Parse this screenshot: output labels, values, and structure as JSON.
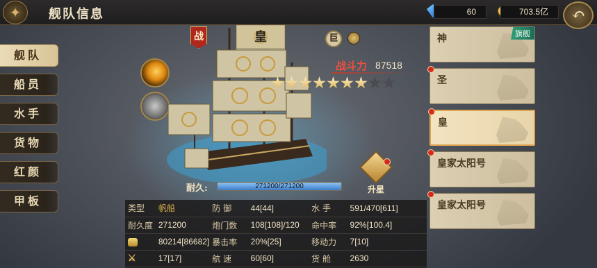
{
  "header": {
    "title": "舰队信息",
    "gems": "60",
    "gold": "703.5亿",
    "back_icon": "back-arrow-icon"
  },
  "left_tabs": [
    {
      "label": "舰队",
      "active": true
    },
    {
      "label": "船员",
      "active": false
    },
    {
      "label": "水手",
      "active": false
    },
    {
      "label": "货物",
      "active": false
    },
    {
      "label": "红颜",
      "active": false
    },
    {
      "label": "甲板",
      "active": false
    }
  ],
  "ship": {
    "emblem": "战",
    "name": "皇",
    "size_badge": "巨",
    "power_label": "战斗力",
    "power_value": "87518",
    "stars_total": 9,
    "stars_filled": 7,
    "durability_label": "耐久:",
    "durability_text": "271200/271200",
    "durability_fraction": 1.0,
    "upstar_label": "升星"
  },
  "stats": {
    "rows": [
      [
        {
          "label": "类型"
        },
        {
          "value": "帆船",
          "gold": true
        },
        {
          "label": "防 御"
        },
        {
          "value": "44[44]"
        },
        {
          "label": "水 手"
        },
        {
          "value": "591/470[611]"
        }
      ],
      [
        {
          "label": "耐久度"
        },
        {
          "value": "271200"
        },
        {
          "label": "炮门数"
        },
        {
          "value": "108[108]/120"
        },
        {
          "label": "命中率"
        },
        {
          "value": "92%[100.4]"
        }
      ],
      [
        {
          "icon": "cannon-icon"
        },
        {
          "value": "80214[86682]"
        },
        {
          "label": "暴击率"
        },
        {
          "value": "20%[25]"
        },
        {
          "label": "移动力"
        },
        {
          "value": "7[10]"
        }
      ],
      [
        {
          "icon": "crossed-swords-icon"
        },
        {
          "value": "17[17]"
        },
        {
          "label": "航 速"
        },
        {
          "value": "60[60]"
        },
        {
          "label": "货 舱"
        },
        {
          "value": "2630"
        }
      ]
    ]
  },
  "fleet": [
    {
      "name": "神",
      "tag": "旗舰",
      "dot": false,
      "active": false
    },
    {
      "name": "圣",
      "tag": "",
      "dot": true,
      "active": false
    },
    {
      "name": "皇",
      "tag": "",
      "dot": true,
      "active": true
    },
    {
      "name": "皇家太阳号",
      "tag": "",
      "dot": true,
      "active": false
    },
    {
      "name": "皇家太阳号",
      "tag": "",
      "dot": true,
      "active": false
    }
  ]
}
